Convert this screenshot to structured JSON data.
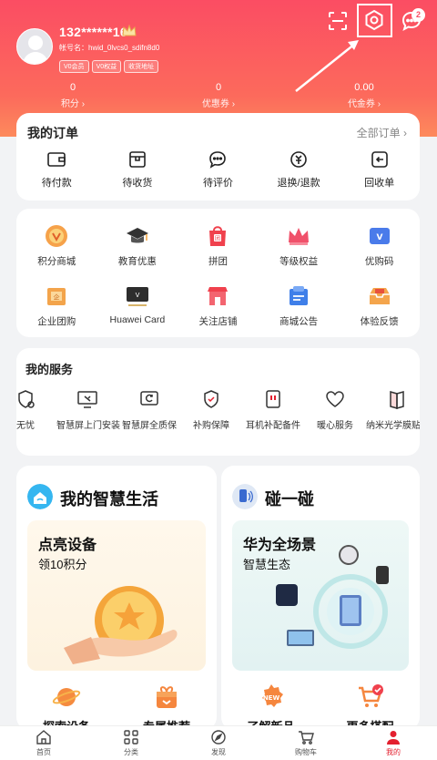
{
  "header": {
    "username": "132******16",
    "account": "帐号名：hwid_0lvcs0_sdifn8d0",
    "badges": [
      "V0会员",
      "V0权益",
      "收货地址"
    ],
    "message_count": "2",
    "accent_color": "#fb4d63"
  },
  "stats": [
    {
      "value": "0",
      "label": "积分 ›"
    },
    {
      "value": "0",
      "label": "优惠券 ›"
    },
    {
      "value": "0.00",
      "label": "代金券 ›"
    }
  ],
  "orders": {
    "title": "我的订单",
    "all_label": "全部订单 ›",
    "items": [
      {
        "label": "待付款",
        "icon": "wallet-icon"
      },
      {
        "label": "待收货",
        "icon": "package-icon"
      },
      {
        "label": "待评价",
        "icon": "comment-icon"
      },
      {
        "label": "退换/退款",
        "icon": "refund-icon"
      },
      {
        "label": "回收单",
        "icon": "recycle-icon"
      }
    ]
  },
  "grid": {
    "row1": [
      {
        "label": "积分商城",
        "icon": "points-mall-icon"
      },
      {
        "label": "教育优惠",
        "icon": "graduation-cap-icon"
      },
      {
        "label": "拼团",
        "icon": "group-buy-icon"
      },
      {
        "label": "等级权益",
        "icon": "crown-icon"
      },
      {
        "label": "优购码",
        "icon": "vip-code-icon"
      }
    ],
    "row2": [
      {
        "label": "企业团购",
        "icon": "enterprise-icon"
      },
      {
        "label": "Huawei Card",
        "icon": "huawei-card-icon"
      },
      {
        "label": "关注店铺",
        "icon": "store-icon"
      },
      {
        "label": "商城公告",
        "icon": "notice-icon"
      },
      {
        "label": "体验反馈",
        "icon": "feedback-icon"
      }
    ]
  },
  "services": {
    "title": "我的服务",
    "items": [
      {
        "label": "无忧",
        "icon": "shield-clock-icon"
      },
      {
        "label": "智慧屏上门安装",
        "icon": "tv-install-icon"
      },
      {
        "label": "智慧屏全质保",
        "icon": "tv-warranty-icon"
      },
      {
        "label": "补购保障",
        "icon": "shield-check-icon"
      },
      {
        "label": "耳机补配备件",
        "icon": "earphone-icon"
      },
      {
        "label": "暖心服务",
        "icon": "heart-icon"
      },
      {
        "label": "纳米光学膜贴膜",
        "icon": "film-icon"
      }
    ]
  },
  "smart_life": {
    "title": "我的智慧生活",
    "promo_title": "点亮设备",
    "promo_sub": "领10积分",
    "sub_items": [
      {
        "label": "探索设备",
        "icon": "planet-icon"
      },
      {
        "label": "专属推荐",
        "icon": "gift-icon"
      }
    ]
  },
  "tap": {
    "title": "碰一碰",
    "promo_title": "华为全场景",
    "promo_sub": "智慧生态",
    "sub_items": [
      {
        "label": "了解新品",
        "icon": "new-badge-icon"
      },
      {
        "label": "更多搭配",
        "icon": "cart-check-icon"
      }
    ]
  },
  "tabbar": [
    {
      "label": "首页",
      "icon": "home-icon"
    },
    {
      "label": "分类",
      "icon": "category-icon"
    },
    {
      "label": "发现",
      "icon": "compass-icon"
    },
    {
      "label": "购物车",
      "icon": "cart-icon"
    },
    {
      "label": "我的",
      "icon": "profile-icon",
      "active": true
    }
  ]
}
